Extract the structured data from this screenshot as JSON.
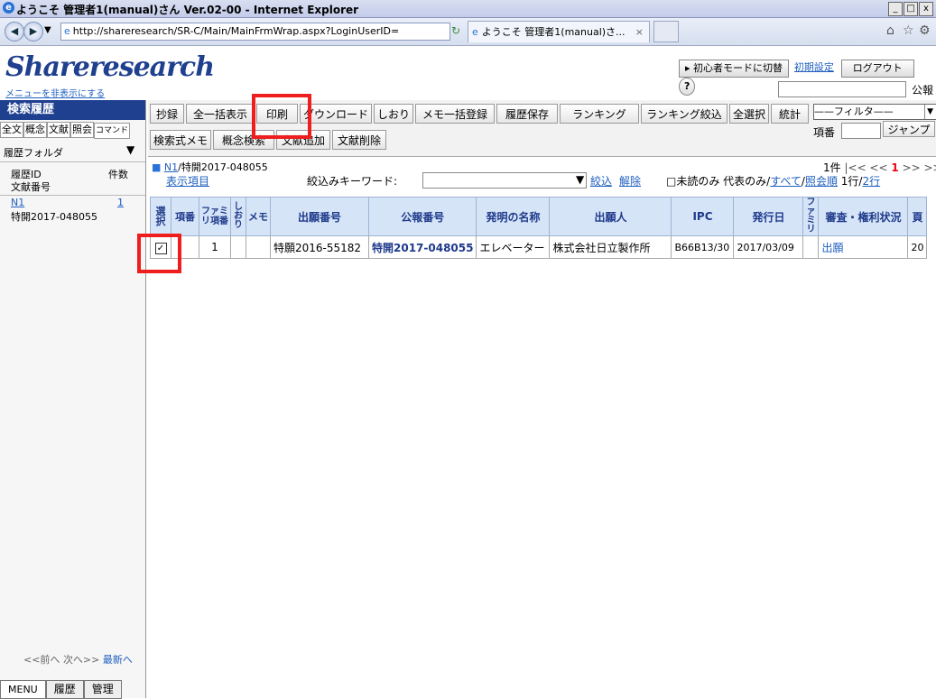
{
  "window": {
    "title": "ようこそ 管理者1(manual)さん  Ver.02-00 - Internet Explorer",
    "url": "http://shareresearch/SR-C/Main/MainFrmWrap.aspx?LoginUserID=",
    "tab_title": "ようこそ 管理者1(manual)さ..."
  },
  "header": {
    "logo": "Shareresearch",
    "hide_menu": "メニューを非表示にする",
    "beginner_mode": "▸ 初心者モードに切替",
    "initial_settings": "初期設定",
    "logout": "ログアウト",
    "help": "?",
    "koho": "公報"
  },
  "sidebar": {
    "title": "検索履歴",
    "tabs": [
      "全文",
      "概念",
      "文献",
      "照会",
      "コマンド"
    ],
    "folder": "履歴フォルダ",
    "col_id": "履歴ID",
    "col_doc": "文献番号",
    "col_count": "件数",
    "entry_id": "N1",
    "entry_count": "1",
    "entry_doc": "特開2017-048055",
    "footer_prev": "<<前へ",
    "footer_next": "次へ>>",
    "footer_latest": "最新へ",
    "bottom_tabs": [
      "MENU",
      "履歴",
      "管理"
    ]
  },
  "toolbar": {
    "row1": [
      "抄録",
      "全一括表示",
      "印刷",
      "ダウンロード",
      "しおり",
      "メモ一括登録",
      "履歴保存",
      "ランキング",
      "ランキング絞込",
      "全選択",
      "統計"
    ],
    "row2": [
      "検索式メモ",
      "概念検索",
      "文献追加",
      "文献削除"
    ],
    "filter": "——フィルタ——",
    "jump_label": "項番",
    "jump_button": "ジャンプ"
  },
  "content": {
    "breadcrumb_id": "N1",
    "breadcrumb_doc": "/特開2017-048055",
    "display_items": "表示項目",
    "keyword_label": "絞込みキーワード:",
    "narrow": "絞込",
    "release": "解除",
    "unread_only": "□未読のみ",
    "rep_only": "代表のみ/",
    "all": "すべて",
    "sep": "/",
    "ref_order": "照会順",
    "rows_per": "1行/",
    "two_rows": "2行",
    "count": "1件",
    "pager": "|<< <<",
    "page": "1",
    "pager_next": ">> >>|"
  },
  "table": {
    "headers": [
      "選択",
      "項番",
      "ファミリ項番",
      "しおり",
      "メモ",
      "出願番号",
      "公報番号",
      "発明の名称",
      "出願人",
      "IPC",
      "発行日",
      "ファミリ",
      "審査・権利状況",
      "頁"
    ],
    "row": {
      "no": "1",
      "app_no": "特願2016-55182",
      "pub_no": "特開2017-048055",
      "title": "エレベーター",
      "applicant": "株式会社日立製作所",
      "ipc": "B66B13/30",
      "date": "2017/03/09",
      "status": "出願",
      "page": "20"
    }
  },
  "colors": {
    "accent": "#1f3f8f",
    "highlight": "#ef1d1d"
  }
}
